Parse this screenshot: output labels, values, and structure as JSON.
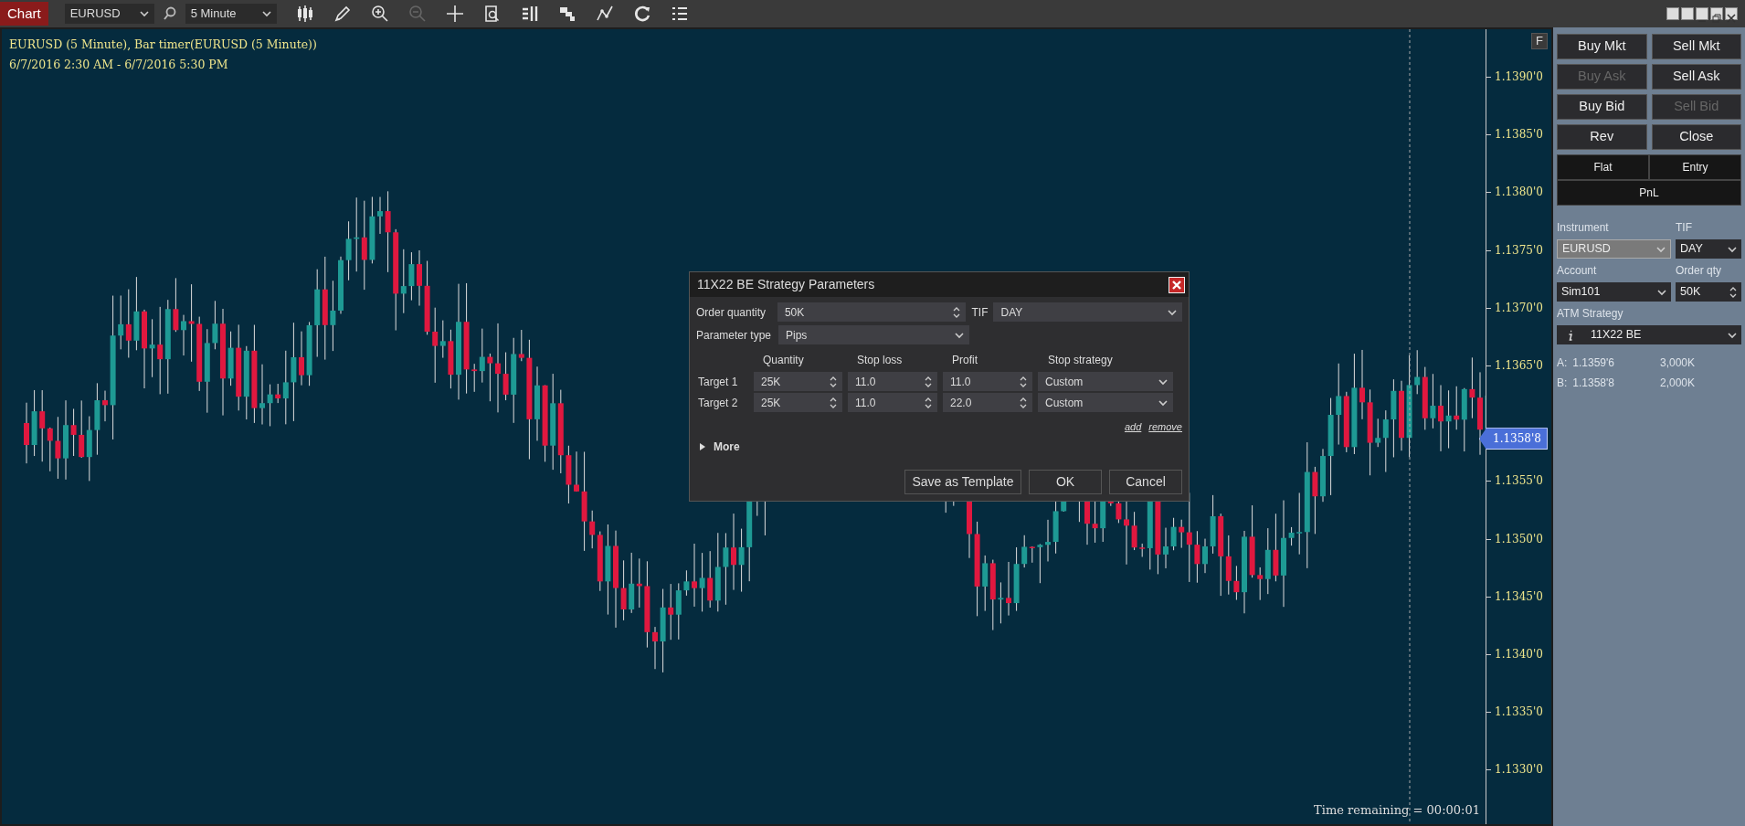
{
  "toolbar": {
    "logo": "Chart",
    "instrument": "EURUSD",
    "interval": "5 Minute",
    "tools": [
      {
        "kind": "candlestick",
        "disabled": false
      },
      {
        "kind": "pencil",
        "disabled": false
      },
      {
        "kind": "zoom-in",
        "disabled": false
      },
      {
        "kind": "zoom-out",
        "disabled": true
      },
      {
        "kind": "crosshair",
        "disabled": false
      },
      {
        "kind": "document-search",
        "disabled": false
      },
      {
        "kind": "columns",
        "disabled": false
      },
      {
        "kind": "squares",
        "disabled": false
      },
      {
        "kind": "line-chart",
        "disabled": false
      },
      {
        "kind": "refresh",
        "disabled": false
      },
      {
        "kind": "list",
        "disabled": false
      }
    ]
  },
  "chart": {
    "title": "EURUSD (5 Minute), Bar timer(EURUSD (5 Minute))",
    "range": "6/7/2016 2:30 AM - 6/7/2016 5:30 PM",
    "f_button": "F",
    "price_labels_upper": [
      "1.1390'0",
      "1.1385'0",
      "1.1380'0",
      "1.1375'0",
      "1.1370'0",
      "1.1365'0"
    ],
    "price_labels_lower": [
      "1.1355'0",
      "1.1350'0",
      "1.1345'0",
      "1.1340'0",
      "1.1335'0",
      "1.1330'0"
    ],
    "last_price": "1.1358'8",
    "timer": "Time remaining = 00:00:01"
  },
  "dialog": {
    "title": "11X22 BE Strategy Parameters",
    "order_quantity": {
      "label": "Order quantity",
      "value": "50K"
    },
    "tif": {
      "label": "TIF",
      "value": "DAY"
    },
    "parameter_type": {
      "label": "Parameter type",
      "value": "Pips"
    },
    "columns": [
      "Quantity",
      "Stop loss",
      "Profit",
      "Stop strategy"
    ],
    "targets": [
      {
        "label": "Target 1",
        "quantity": "25K",
        "stop_loss": "11.0",
        "profit": "11.0",
        "stop_strategy": "Custom"
      },
      {
        "label": "Target 2",
        "quantity": "25K",
        "stop_loss": "11.0",
        "profit": "22.0",
        "stop_strategy": "Custom"
      }
    ],
    "links": [
      "add",
      "remove"
    ],
    "more": "More",
    "expanded": false,
    "buttons": [
      "Save as Template",
      "OK",
      "Cancel"
    ]
  },
  "panel": {
    "buttons": [
      {
        "label": "Buy Mkt",
        "disabled": false
      },
      {
        "label": "Sell Mkt",
        "disabled": false
      },
      {
        "label": "Buy Ask",
        "disabled": true
      },
      {
        "label": "Sell Ask",
        "disabled": false
      },
      {
        "label": "Buy Bid",
        "disabled": false
      },
      {
        "label": "Sell Bid",
        "disabled": true
      },
      {
        "label": "Rev",
        "disabled": false
      },
      {
        "label": "Close",
        "disabled": false
      }
    ],
    "flat": "Flat",
    "entry": "Entry",
    "pnl": "PnL",
    "instrument": {
      "label": "Instrument",
      "value": "EURUSD",
      "disabled": true
    },
    "tif": {
      "label": "TIF",
      "value": "DAY",
      "disabled": false
    },
    "account": {
      "label": "Account",
      "value": "Sim101",
      "disabled": false
    },
    "order_qty": {
      "label": "Order qty",
      "value": "50K"
    },
    "atm_strategy": {
      "label": "ATM Strategy",
      "value": "11X22 BE"
    },
    "quotes": [
      {
        "label": "A:",
        "price": "1.1359'6",
        "size": "3,000K"
      },
      {
        "label": "B:",
        "price": "1.1358'8",
        "size": "2,000K"
      }
    ]
  }
}
